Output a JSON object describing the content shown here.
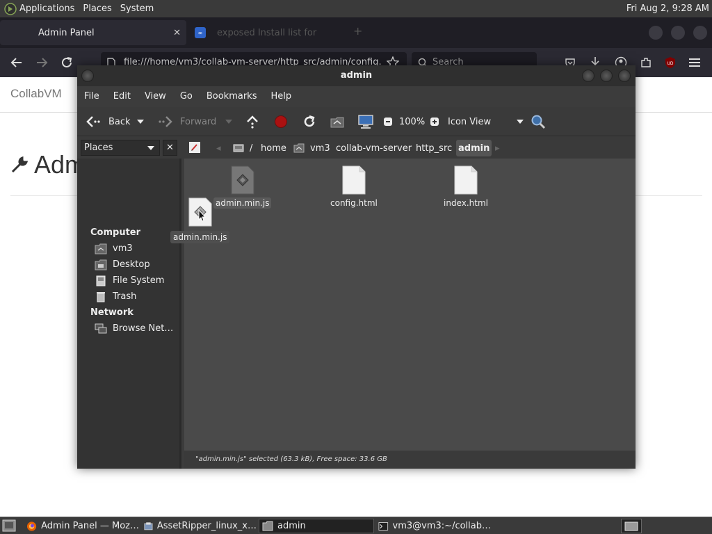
{
  "top_panel": {
    "menus": [
      "Applications",
      "Places",
      "System"
    ],
    "clock": "Fri Aug  2,  9:28 AM"
  },
  "browser": {
    "tabs": [
      {
        "label": "Admin Panel",
        "close": "✕"
      },
      {
        "label": "exposed Install list for"
      }
    ],
    "url": "file:///home/vm3/collab-vm-server/http_src/admin/config.",
    "search_placeholder": "Search",
    "page": {
      "brand": "CollabVM",
      "heading": "Admin Panel"
    }
  },
  "caja": {
    "title": "admin",
    "menu": [
      "File",
      "Edit",
      "View",
      "Go",
      "Bookmarks",
      "Help"
    ],
    "toolbar": {
      "back": "Back",
      "forward": "Forward",
      "zoom": "100%",
      "view_mode": "Icon View"
    },
    "sidebar_mode": "Places",
    "path": [
      "/",
      "home",
      "vm3",
      "collab-vm-server",
      "http_src",
      "admin"
    ],
    "sidebar": {
      "computer_header": "Computer",
      "computer_items": [
        "vm3",
        "Desktop",
        "File System",
        "Trash"
      ],
      "network_header": "Network",
      "network_items": [
        "Browse Net…"
      ]
    },
    "files": [
      {
        "name": "admin.min.js",
        "type": "js",
        "selected": true
      },
      {
        "name": "config.html",
        "type": "html",
        "selected": false
      },
      {
        "name": "index.html",
        "type": "html",
        "selected": false
      }
    ],
    "drag_item": "admin.min.js",
    "status": "\"admin.min.js\" selected (63.3 kB), Free space: 33.6 GB"
  },
  "taskbar": {
    "tasks": [
      {
        "label": "Admin Panel — Moz…",
        "icon": "firefox-icon"
      },
      {
        "label": "AssetRipper_linux_x…",
        "icon": "archive-icon"
      },
      {
        "label": "admin",
        "icon": "folder-icon",
        "active": true
      },
      {
        "label": "vm3@vm3:~/collab…",
        "icon": "terminal-icon"
      }
    ]
  }
}
